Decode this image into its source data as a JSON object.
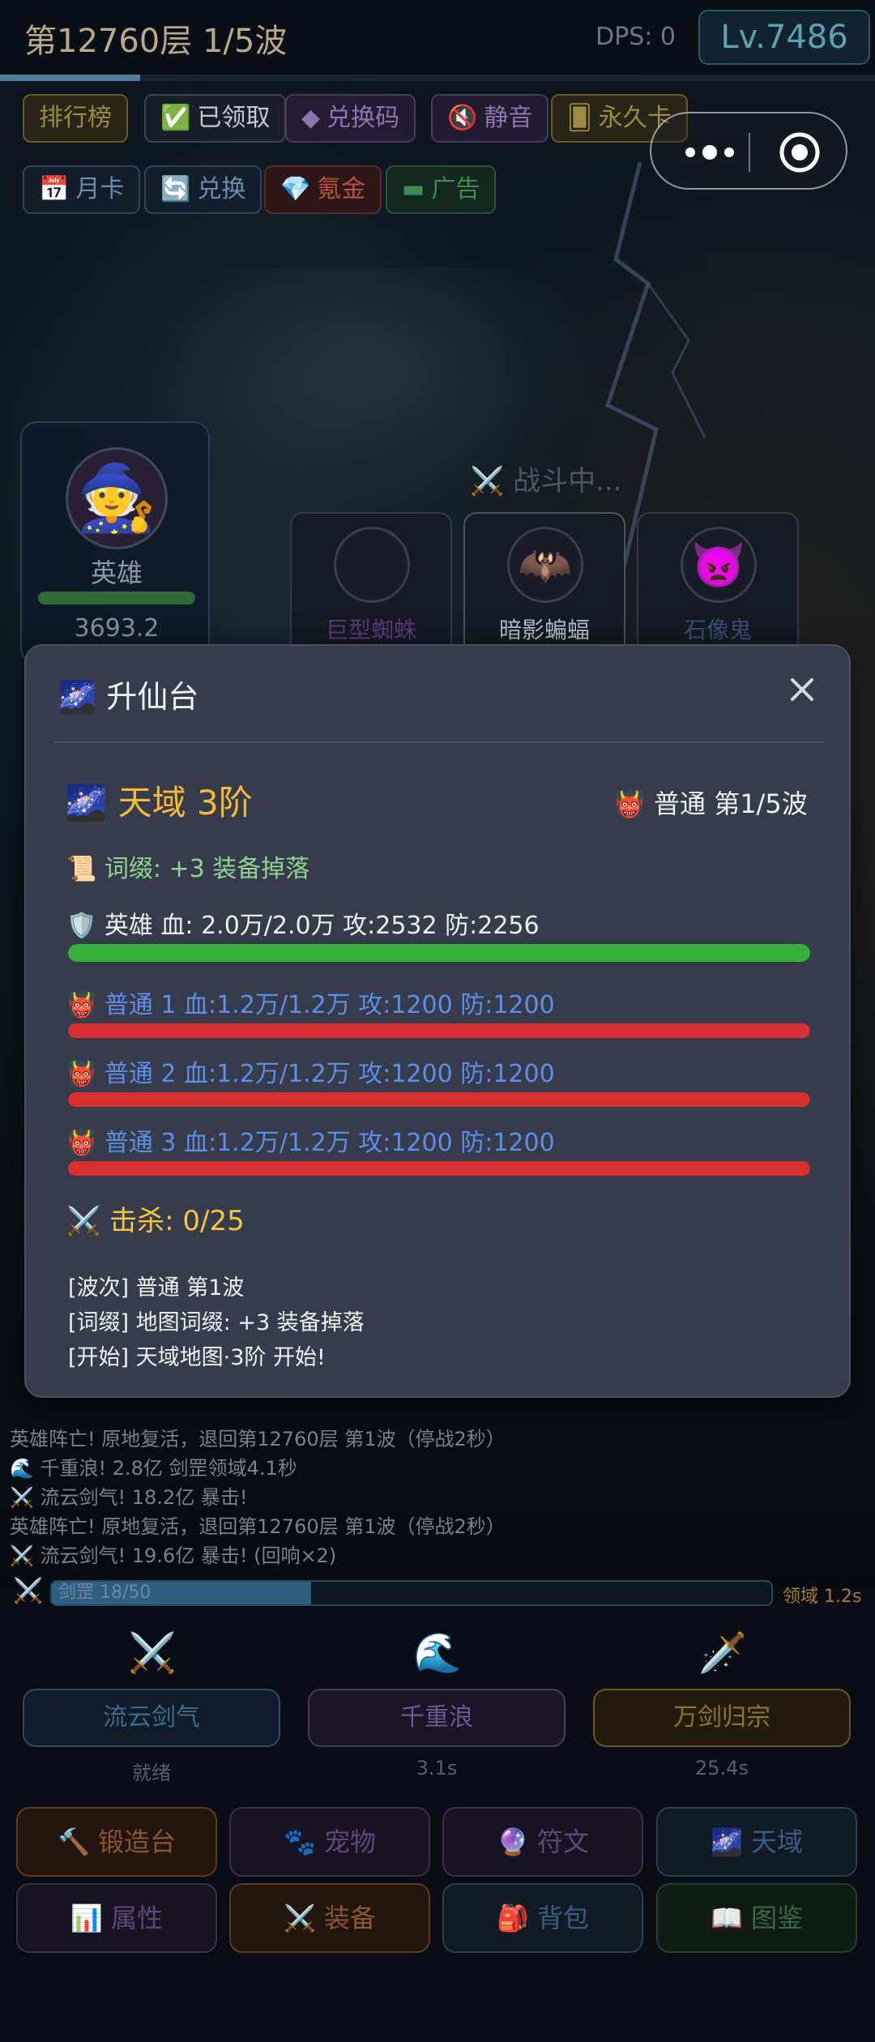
{
  "header": {
    "floor_title": "第12760层 1/5波",
    "dps": "DPS: 0",
    "level": "Lv.7486",
    "wave_progress": 0.16
  },
  "chips_row1": [
    {
      "icon": "",
      "label": "排行榜"
    },
    {
      "icon": "✅",
      "label": "已领取"
    },
    {
      "icon": "◆",
      "label": "兑换码"
    },
    {
      "icon": "🔇",
      "label": "静音"
    },
    {
      "icon": "🂠",
      "label": "永久卡"
    }
  ],
  "chips_row2": [
    {
      "icon": "📅",
      "label": "月卡"
    },
    {
      "icon": "🔄",
      "label": "兑换"
    },
    {
      "icon": "💎",
      "label": "氪金"
    },
    {
      "icon": "▬",
      "label": "广告"
    }
  ],
  "hero": {
    "avatar": "🧙",
    "name": "英雄",
    "hp": "3693.2"
  },
  "battle": {
    "status": "⚔️ 战斗中..."
  },
  "enemies": [
    {
      "icon": "",
      "name": "巨型蜘蛛",
      "color": "#5b3a78"
    },
    {
      "icon": "🦇",
      "name": "暗影蝙蝠",
      "color": "#b7bcc8"
    },
    {
      "icon": "👿",
      "name": "石像鬼",
      "color": "#3e4d7a"
    }
  ],
  "modal": {
    "title": "🌌 升仙台",
    "realm": "🌌 天域 3阶",
    "wave": "👹 普通 第1/5波",
    "affix": "📜 词缀: +3 装备掉落",
    "hero_line": "🛡️ 英雄  血: 2.0万/2.0万  攻:2532  防:2256",
    "hero_hp_ratio": 1.0,
    "enemies": [
      {
        "line": "👹 普通 1  血:1.2万/1.2万  攻:1200 防:1200",
        "hp_ratio": 1.0
      },
      {
        "line": "👹 普通 2  血:1.2万/1.2万  攻:1200 防:1200",
        "hp_ratio": 1.0
      },
      {
        "line": "👹 普通 3  血:1.2万/1.2万  攻:1200 防:1200",
        "hp_ratio": 1.0
      }
    ],
    "kills": "⚔️ 击杀: 0/25",
    "log": [
      "[波次] 普通 第1波",
      "[词缀] 地图词缀: +3 装备掉落",
      "[开始] 天域地图·3阶 开始!"
    ]
  },
  "combat_log": [
    "英雄阵亡! 原地复活，退回第12760层 第1波（停战2秒）",
    "🌊 千重浪! 2.8亿 剑罡领域4.1秒",
    "⚔️ 流云剑气! 18.2亿 暴击!",
    "英雄阵亡! 原地复活，退回第12760层 第1波（停战2秒）",
    "⚔️ 流云剑气! 19.6亿 暴击! (回响×2)"
  ],
  "sword_bar": {
    "icon": "⚔️",
    "label": "剑罡 18/50",
    "ratio": 0.36,
    "domain_time": "领域 1.2s"
  },
  "skills": [
    {
      "icon": "⚔️",
      "label": "流云剑气",
      "cd": "就绪"
    },
    {
      "icon": "🌊",
      "label": "千重浪",
      "cd": "3.1s"
    },
    {
      "icon": "🗡️",
      "label": "万剑归宗",
      "cd": "25.4s"
    }
  ],
  "nav": [
    {
      "label": "🔨 锻造台"
    },
    {
      "label": "🐾 宠物"
    },
    {
      "label": "🔮 符文"
    },
    {
      "label": "🌌 天域"
    },
    {
      "label": "📊 属性"
    },
    {
      "label": "⚔️ 装备"
    },
    {
      "label": "🎒 背包"
    },
    {
      "label": "📖 图鉴"
    }
  ],
  "colors": {
    "gold": "#f5b93a",
    "hero_bar": "#33b13a",
    "enemy_bar": "#d8302f",
    "enemy_text": "#5e8ee6",
    "affix_text": "#8fd48f"
  }
}
